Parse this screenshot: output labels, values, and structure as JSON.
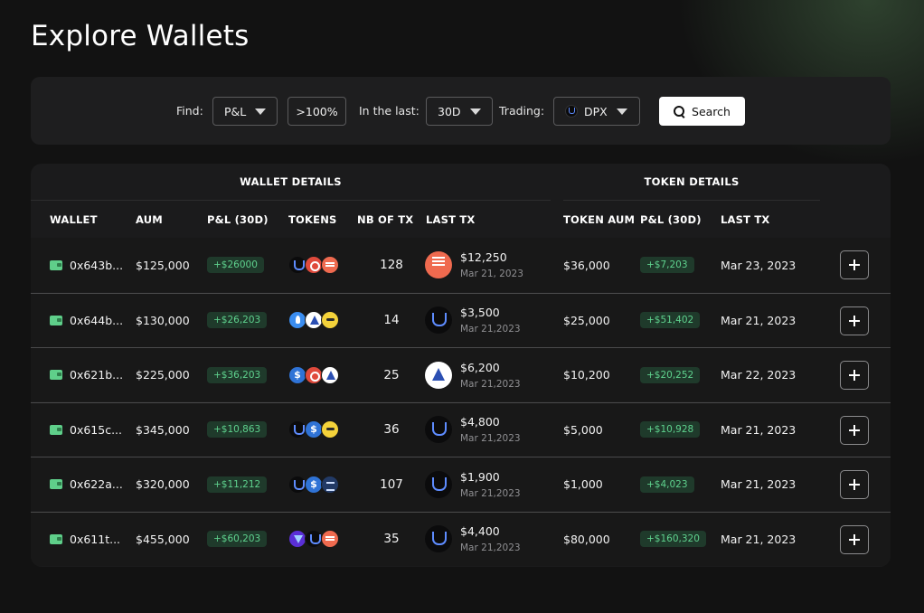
{
  "title": "Explore Wallets",
  "filters": {
    "find_label": "Find:",
    "find_value": "P&L",
    "threshold_value": ">100%",
    "period_label": "In the last:",
    "period_value": "30D",
    "trading_label": "Trading:",
    "trading_value": "DPX",
    "trading_icon": "dpx-token-icon",
    "search_label": "Search"
  },
  "table": {
    "group_wallet": "WALLET DETAILS",
    "group_token": "TOKEN DETAILS",
    "columns": {
      "wallet": "WALLET",
      "aum": "AUM",
      "pnl": "P&L (30D)",
      "tokens": "TOKENS",
      "nb_tx": "NB OF TX",
      "last_tx": "LAST TX",
      "token_aum": "TOKEN AUM",
      "token_pnl": "P&L (30D)",
      "token_last_tx": "LAST TX"
    },
    "rows": [
      {
        "wallet": "0x643b...",
        "aum": "$125,000",
        "pnl": "+$26000",
        "tokens": [
          "dpx",
          "red",
          "orange"
        ],
        "nb_tx": "128",
        "last_tx_icon": "orange",
        "last_tx_amount": "$12,250",
        "last_tx_date": "Mar 21, 2023",
        "token_aum": "$36,000",
        "token_pnl": "+$7,203",
        "token_last_tx": "Mar 23, 2023"
      },
      {
        "wallet": "0x644b...",
        "aum": "$130,000",
        "pnl": "+$26,203",
        "tokens": [
          "blue",
          "arb",
          "yellow"
        ],
        "nb_tx": "14",
        "last_tx_icon": "dpx",
        "last_tx_amount": "$3,500",
        "last_tx_date": "Mar 21,2023",
        "token_aum": "$25,000",
        "token_pnl": "+$51,402",
        "token_last_tx": "Mar 21, 2023"
      },
      {
        "wallet": "0x621b...",
        "aum": "$225,000",
        "pnl": "+$36,203",
        "tokens": [
          "usdc",
          "red",
          "arb"
        ],
        "nb_tx": "25",
        "last_tx_icon": "arb",
        "last_tx_amount": "$6,200",
        "last_tx_date": "Mar 21,2023",
        "token_aum": "$10,200",
        "token_pnl": "+$20,252",
        "token_last_tx": "Mar 22, 2023"
      },
      {
        "wallet": "0x615c...",
        "aum": "$345,000",
        "pnl": "+$10,863",
        "tokens": [
          "dpx",
          "usdc",
          "yellow"
        ],
        "nb_tx": "36",
        "last_tx_icon": "dpx",
        "last_tx_amount": "$4,800",
        "last_tx_date": "Mar 21,2023",
        "token_aum": "$5,000",
        "token_pnl": "+$10,928",
        "token_last_tx": "Mar 21, 2023"
      },
      {
        "wallet": "0x622a...",
        "aum": "$320,000",
        "pnl": "+$11,212",
        "tokens": [
          "dpx",
          "usdc",
          "navy"
        ],
        "nb_tx": "107",
        "last_tx_icon": "dpx",
        "last_tx_amount": "$1,900",
        "last_tx_date": "Mar 21,2023",
        "token_aum": "$1,000",
        "token_pnl": "+$4,023",
        "token_last_tx": "Mar 21, 2023"
      },
      {
        "wallet": "0x611t...",
        "aum": "$455,000",
        "pnl": "+$60,203",
        "tokens": [
          "purple",
          "dpx",
          "orange"
        ],
        "nb_tx": "35",
        "last_tx_icon": "dpx",
        "last_tx_amount": "$4,400",
        "last_tx_date": "Mar 21,2023",
        "token_aum": "$80,000",
        "token_pnl": "+$160,320",
        "token_last_tx": "Mar 21, 2023"
      }
    ]
  },
  "colors": {
    "background": "#121212",
    "panel": "#1e1e1f",
    "row": "#181818",
    "positive_text": "#5fd28e",
    "positive_bg": "#1f3a2b",
    "wallet_icon": "#5fcf8a"
  }
}
